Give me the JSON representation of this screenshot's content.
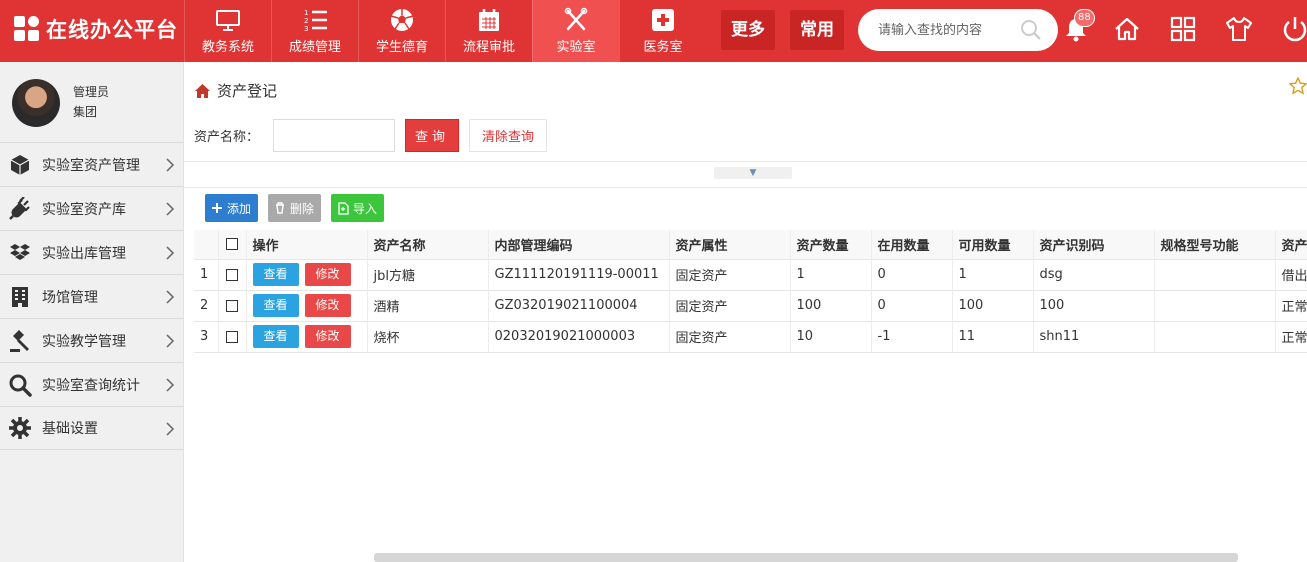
{
  "app": {
    "title": "在线办公平台"
  },
  "topnav": {
    "items": [
      {
        "label": "教务系统",
        "icon": "monitor-icon"
      },
      {
        "label": "成绩管理",
        "icon": "numbered-list-icon"
      },
      {
        "label": "学生德育",
        "icon": "soccer-ball-icon"
      },
      {
        "label": "流程审批",
        "icon": "calendar-icon"
      },
      {
        "label": "实验室",
        "icon": "lab-tools-icon",
        "active": true
      },
      {
        "label": "医务室",
        "icon": "medical-cross-icon"
      }
    ],
    "more_label": "更多",
    "common_label": "常用",
    "search_placeholder": "请输入查找的内容",
    "notification_count": "88"
  },
  "user": {
    "name": "管理员",
    "org": "集团"
  },
  "sidebar": {
    "items": [
      {
        "label": "实验室资产管理",
        "icon": "cube-icon"
      },
      {
        "label": "实验室资产库",
        "icon": "plug-icon"
      },
      {
        "label": "实验出库管理",
        "icon": "dropbox-icon"
      },
      {
        "label": "场馆管理",
        "icon": "building-icon"
      },
      {
        "label": "实验教学管理",
        "icon": "gavel-icon"
      },
      {
        "label": "实验室查询统计",
        "icon": "search-icon"
      },
      {
        "label": "基础设置",
        "icon": "gear-icon"
      }
    ]
  },
  "page": {
    "title": "资产登记",
    "filter_label": "资产名称：",
    "filter_value": "",
    "query_label": "查询",
    "clear_label": "清除查询"
  },
  "toolbar": {
    "add_label": "添加",
    "delete_label": "删除",
    "import_label": "导入"
  },
  "table": {
    "columns": [
      "操作",
      "资产名称",
      "内部管理编码",
      "资产属性",
      "资产数量",
      "在用数量",
      "可用数量",
      "资产识别码",
      "规格型号功能",
      "资产"
    ],
    "view_label": "查看",
    "edit_label": "修改",
    "rows": [
      {
        "num": "1",
        "name": "jbl方糖",
        "code": "GZ111120191119-00011",
        "attr": "固定资产",
        "qty": "1",
        "in_use": "0",
        "avail": "1",
        "ident": "dsg",
        "spec": "",
        "status": "借出"
      },
      {
        "num": "2",
        "name": "酒精",
        "code": "GZ032019021100004",
        "attr": "固定资产",
        "qty": "100",
        "in_use": "0",
        "avail": "100",
        "ident": "100",
        "spec": "",
        "status": "正常"
      },
      {
        "num": "3",
        "name": "烧杯",
        "code": "02032019021000003",
        "attr": "固定资产",
        "qty": "10",
        "in_use": "-1",
        "avail": "11",
        "ident": "shn11",
        "spec": "",
        "status": "正常"
      }
    ]
  },
  "colors": {
    "brand": "#e03434",
    "primary": "#2d7ed0",
    "danger": "#e84848",
    "info": "#2aa3e0",
    "success": "#3cc63c"
  }
}
